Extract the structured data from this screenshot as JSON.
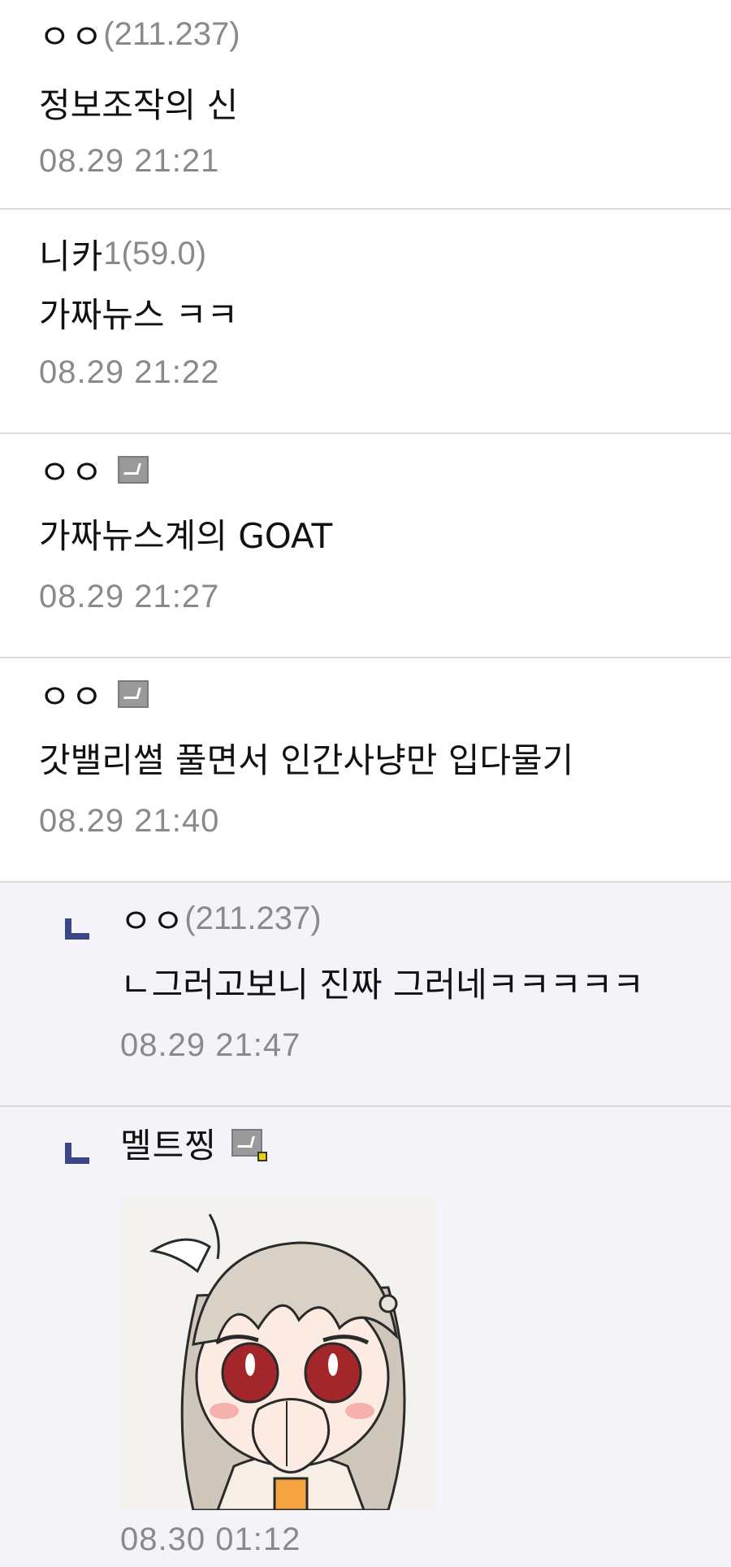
{
  "comments": [
    {
      "nick": "ㅇㅇ",
      "ip": "(211.237)",
      "text": "정보조작의 신",
      "time": "08.29 21:21"
    },
    {
      "nick": "니카",
      "ip": "1(59.0)",
      "text": "가짜뉴스 ㅋㅋ",
      "time": "08.29 21:22"
    },
    {
      "nick": "ㅇㅇ",
      "text": "가짜뉴스계의 GOAT",
      "time": "08.29 21:27"
    },
    {
      "nick": "ㅇㅇ",
      "text": "갓밸리썰 풀면서 인간사냥만 입다물기",
      "time": "08.29 21:40"
    },
    {
      "nick": "ㅇㅇ",
      "ip": "(211.237)",
      "text": "ㄴ그러고보니 진짜 그러네ㅋㅋㅋㅋㅋ",
      "time": "08.29 21:47"
    },
    {
      "nick": "멜트찡",
      "time": "08.30 01:12"
    }
  ],
  "colors": {
    "reply_bg": "#f4f4f8",
    "reply_arrow": "#3a4688",
    "meta_gray": "#8a8a8a"
  },
  "icons": {
    "member_badge": "fixed-nick-badge-icon",
    "sub_badge": "sub-manager-badge-icon",
    "reply": "reply-arrow-icon"
  }
}
